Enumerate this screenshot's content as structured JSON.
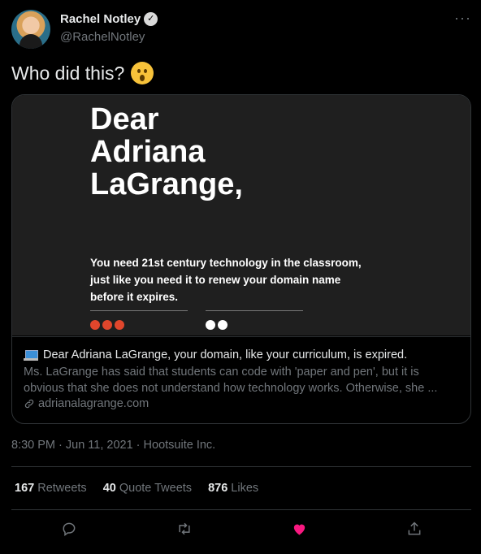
{
  "author": {
    "name": "Rachel Notley",
    "handle": "@RachelNotley",
    "verified_glyph": "✓",
    "more_glyph": "···"
  },
  "tweet": {
    "text": "Who did this?"
  },
  "card": {
    "image": {
      "heading": "Dear\nAdriana\nLaGrange,",
      "body": "You need 21st century technology in the classroom,\njust like you need it to renew your domain name\nbefore it expires.",
      "dot_colors_left": [
        "#e0462c",
        "#e0462c",
        "#e0462c"
      ],
      "dot_colors_right": [
        "#ffffff",
        "#ffffff"
      ]
    },
    "title": "Dear Adriana LaGrange, your domain, like your curriculum, is expired.",
    "description": "Ms. LaGrange has said that students can code with 'paper and pen', but it is obvious that she does not understand how technology works. Otherwise, she ...",
    "link": "adrianalagrange.com"
  },
  "timestamp": "8:30 PM · Jun 11, 2021 · Hootsuite Inc.",
  "stats": {
    "retweets_count": "167",
    "retweets_label": "Retweets",
    "quotes_count": "40",
    "quotes_label": "Quote Tweets",
    "likes_count": "876",
    "likes_label": "Likes"
  },
  "colors": {
    "like_active": "#f91880",
    "icon_gray": "#71767b"
  }
}
